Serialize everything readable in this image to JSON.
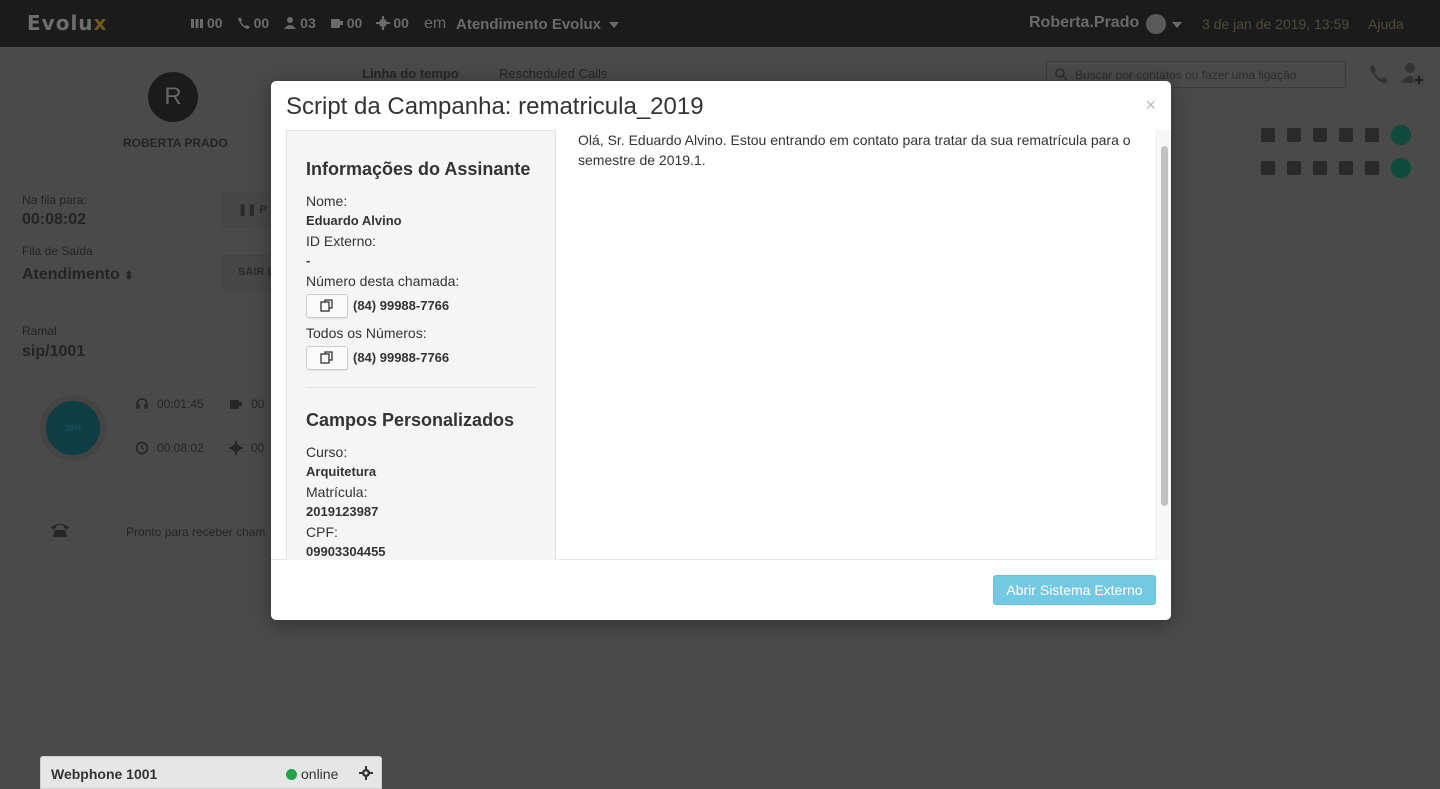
{
  "topbar": {
    "logo": "Evolux",
    "counters": [
      {
        "icon": "queue-icon",
        "value": "00"
      },
      {
        "icon": "phone-icon",
        "value": "00"
      },
      {
        "icon": "user-icon",
        "value": "03"
      },
      {
        "icon": "coffee-icon",
        "value": "00"
      },
      {
        "icon": "gear-icon",
        "value": "00"
      }
    ],
    "em": "em",
    "queue": "Atendimento Evolux",
    "user": "Roberta.Prado",
    "datetime": "3 de jan de 2019, 13:59",
    "help": "Ajuda"
  },
  "agent": {
    "initial": "R",
    "name": "ROBERTA PRADO",
    "queue_label": "Na fila para:",
    "queue_time": "00:08:02",
    "outbound_label": "Fila de Saída",
    "outbound_value": "Atendimento",
    "ramal_label": "Ramal",
    "ramal_value": "sip/1001",
    "pause_button": "P",
    "exit_button": "SAIR D",
    "donut_label": "38%",
    "stat_talk": "00:01:45",
    "stat_pause": "00",
    "stat_time": "00:08:02",
    "stat_other": "00",
    "ready_text": "Pronto para receber cham"
  },
  "main": {
    "tab_timeline": "Linha do tempo",
    "tab_rescheduled": "Rescheduled Calls",
    "search_placeholder": "Buscar por contatos ou fazer uma ligação"
  },
  "modal": {
    "title": "Script da Campanha: rematricula_2019",
    "close": "×",
    "section_subscriber": "Informações do Assinante",
    "name_label": "Nome:",
    "name_value": "Eduardo Alvino",
    "external_id_label": "ID Externo:",
    "external_id_value": "-",
    "call_number_label": "Número desta chamada:",
    "call_number_value": "(84) 99988-7766",
    "all_numbers_label": "Todos os Números:",
    "all_numbers_value": "(84) 99988-7766",
    "section_custom": "Campos Personalizados",
    "course_label": "Curso:",
    "course_value": "Arquitetura",
    "enrollment_label": "Matrícula:",
    "enrollment_value": "2019123987",
    "cpf_label": "CPF:",
    "cpf_value": "09903304455",
    "script_text": "Olá, Sr. Eduardo Alvino. Estou entrando em contato para tratar da sua rematrícula para o semestre de 2019.1.",
    "external_button": "Abrir Sistema Externo"
  },
  "webphone": {
    "title": "Webphone 1001",
    "status": "online"
  },
  "colors": {
    "accent": "#5bc0de",
    "online": "#1fa64a",
    "topbar": "#1b1b1b"
  }
}
